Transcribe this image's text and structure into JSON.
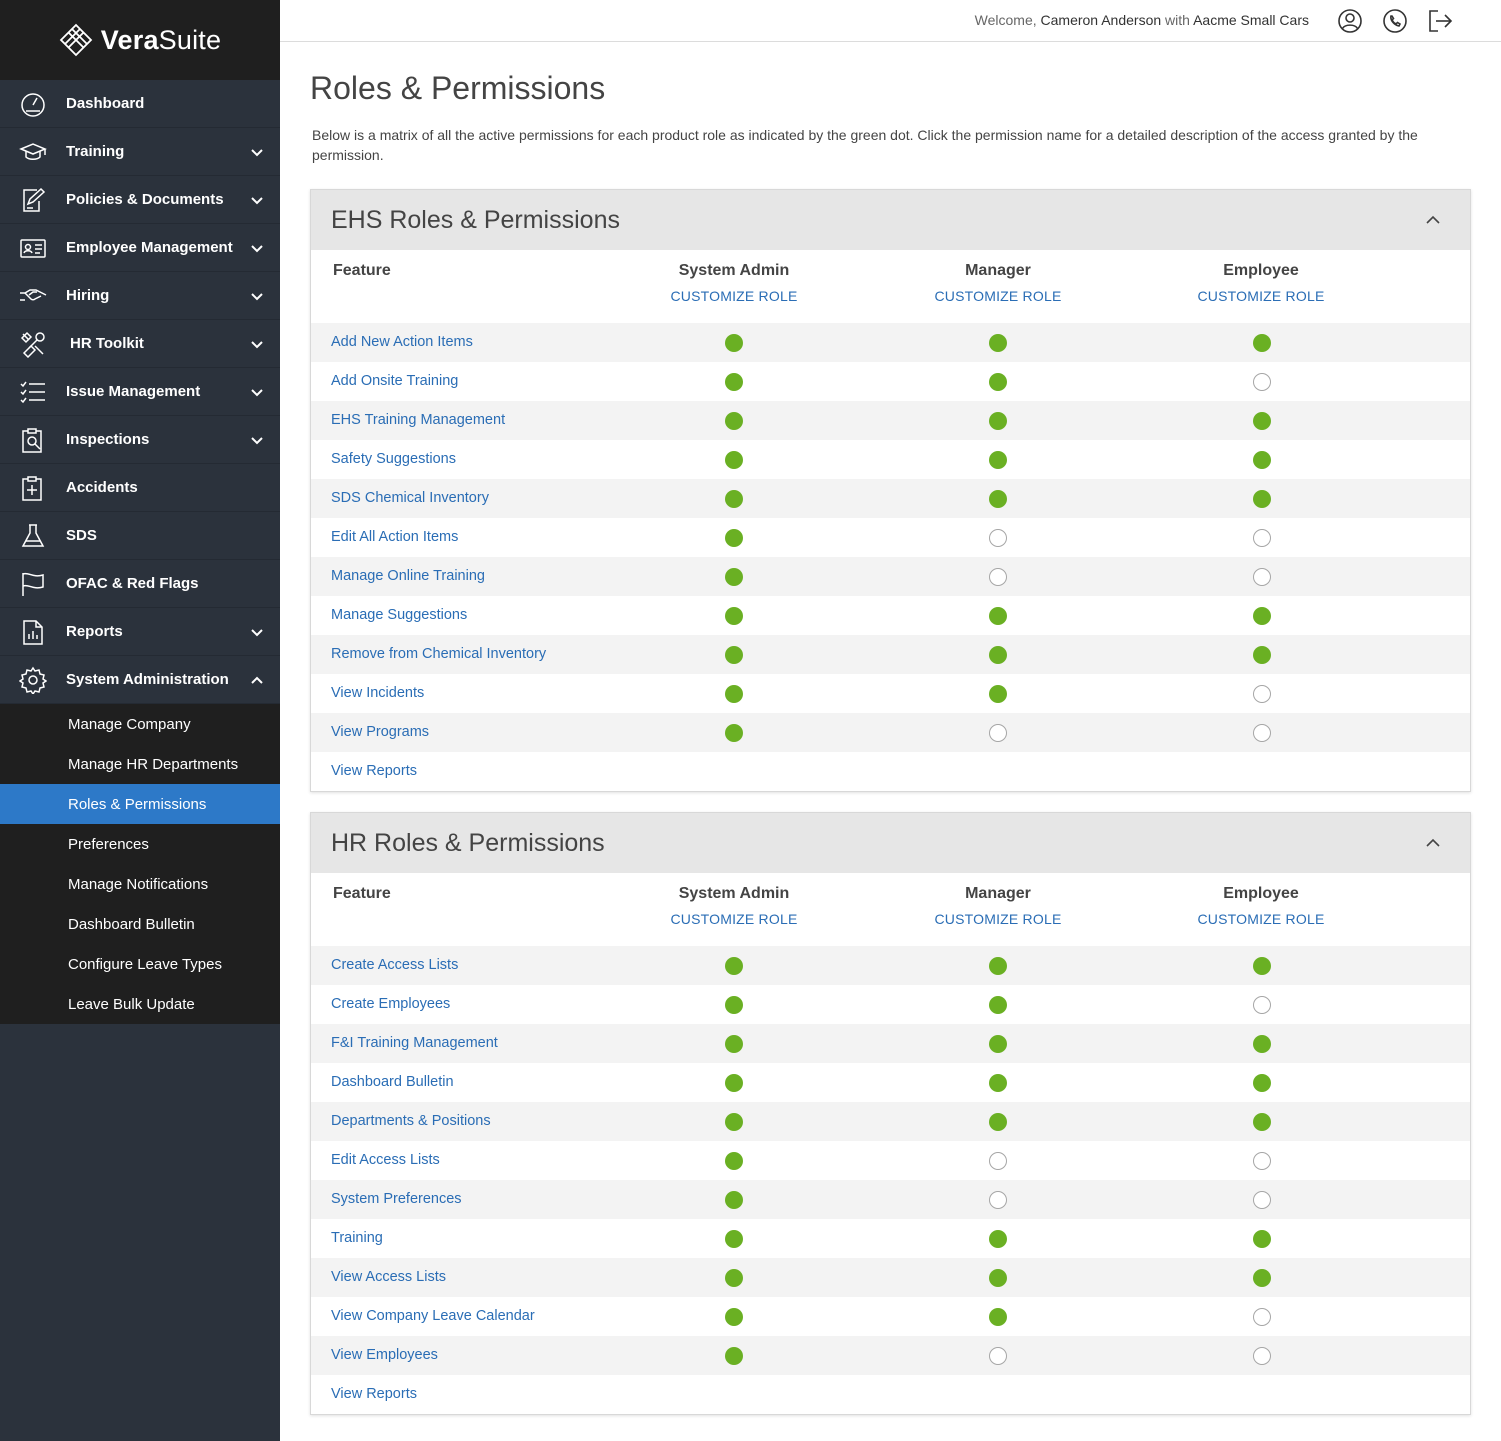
{
  "brand": {
    "name_bold": "Vera",
    "name_rest": "Suite"
  },
  "sidebar": {
    "items": [
      {
        "label": "Dashboard",
        "icon": "gauge-icon",
        "chevron": false
      },
      {
        "label": "Training",
        "icon": "graduation-cap-icon",
        "chevron": true
      },
      {
        "label": "Policies & Documents",
        "icon": "document-pen-icon",
        "chevron": true
      },
      {
        "label": "Employee Management",
        "icon": "id-card-icon",
        "chevron": true
      },
      {
        "label": "Hiring",
        "icon": "handshake-icon",
        "chevron": true
      },
      {
        "label": "HR Toolkit",
        "icon": "tools-icon",
        "chevron": true
      },
      {
        "label": "Issue Management",
        "icon": "checklist-icon",
        "chevron": true
      },
      {
        "label": "Inspections",
        "icon": "clipboard-search-icon",
        "chevron": true
      },
      {
        "label": "Accidents",
        "icon": "medical-clipboard-icon",
        "chevron": false
      },
      {
        "label": "SDS",
        "icon": "flask-icon",
        "chevron": false
      },
      {
        "label": "OFAC & Red Flags",
        "icon": "flag-icon",
        "chevron": false
      },
      {
        "label": "Reports",
        "icon": "report-icon",
        "chevron": true
      },
      {
        "label": "System Administration",
        "icon": "gear-icon",
        "chevron": true,
        "expanded": true
      }
    ],
    "subitems": [
      {
        "label": "Manage Company"
      },
      {
        "label": "Manage HR Departments"
      },
      {
        "label": "Roles & Permissions",
        "active": true
      },
      {
        "label": "Preferences"
      },
      {
        "label": "Manage Notifications"
      },
      {
        "label": "Dashboard Bulletin"
      },
      {
        "label": "Configure Leave Types"
      },
      {
        "label": "Leave Bulk Update"
      }
    ]
  },
  "topbar": {
    "welcome_prefix": "Welcome,",
    "user": "Cameron Anderson",
    "with": "with",
    "company": "Aacme Small Cars",
    "icons": [
      "user-circle-icon",
      "phone-icon",
      "logout-icon"
    ]
  },
  "page": {
    "title": "Roles & Permissions",
    "intro": "Below is a matrix of all the active permissions for each product role as indicated by the green dot. Click the permission name for a detailed description of the access granted by the permission."
  },
  "colors": {
    "active_dot": "#6ab023",
    "link": "#2a6db5",
    "active_nav": "#2d79c8",
    "sidebar_bg": "#2b323c"
  },
  "panels": [
    {
      "title": "EHS Roles & Permissions",
      "feature_header": "Feature",
      "roles": [
        {
          "name": "System Admin",
          "action": "CUSTOMIZE ROLE"
        },
        {
          "name": "Manager",
          "action": "CUSTOMIZE ROLE"
        },
        {
          "name": "Employee",
          "action": "CUSTOMIZE ROLE"
        }
      ],
      "rows": [
        {
          "feature": "Add New Action Items",
          "perms": [
            true,
            true,
            true
          ]
        },
        {
          "feature": "Add Onsite Training",
          "perms": [
            true,
            true,
            false
          ]
        },
        {
          "feature": "EHS Training Management",
          "perms": [
            true,
            true,
            true
          ]
        },
        {
          "feature": "Safety Suggestions",
          "perms": [
            true,
            true,
            true
          ]
        },
        {
          "feature": "SDS Chemical Inventory",
          "perms": [
            true,
            true,
            true
          ]
        },
        {
          "feature": "Edit All Action Items",
          "perms": [
            true,
            false,
            false
          ]
        },
        {
          "feature": "Manage Online Training",
          "perms": [
            true,
            false,
            false
          ]
        },
        {
          "feature": "Manage Suggestions",
          "perms": [
            true,
            true,
            true
          ]
        },
        {
          "feature": "Remove from Chemical Inventory",
          "perms": [
            true,
            true,
            true
          ]
        },
        {
          "feature": "View Incidents",
          "perms": [
            true,
            true,
            false
          ]
        },
        {
          "feature": "View Programs",
          "perms": [
            true,
            false,
            false
          ]
        },
        {
          "feature": "View Reports",
          "perms": [
            null,
            null,
            null
          ]
        }
      ]
    },
    {
      "title": "HR Roles & Permissions",
      "feature_header": "Feature",
      "roles": [
        {
          "name": "System Admin",
          "action": "CUSTOMIZE ROLE"
        },
        {
          "name": "Manager",
          "action": "CUSTOMIZE ROLE"
        },
        {
          "name": "Employee",
          "action": "CUSTOMIZE ROLE"
        }
      ],
      "rows": [
        {
          "feature": "Create Access Lists",
          "perms": [
            true,
            true,
            true
          ]
        },
        {
          "feature": "Create Employees",
          "perms": [
            true,
            true,
            false
          ]
        },
        {
          "feature": "F&I Training Management",
          "perms": [
            true,
            true,
            true
          ]
        },
        {
          "feature": "Dashboard Bulletin",
          "perms": [
            true,
            true,
            true
          ]
        },
        {
          "feature": "Departments & Positions",
          "perms": [
            true,
            true,
            true
          ]
        },
        {
          "feature": "Edit Access Lists",
          "perms": [
            true,
            false,
            false
          ]
        },
        {
          "feature": "System Preferences",
          "perms": [
            true,
            false,
            false
          ]
        },
        {
          "feature": "Training",
          "perms": [
            true,
            true,
            true
          ]
        },
        {
          "feature": "View Access Lists",
          "perms": [
            true,
            true,
            true
          ]
        },
        {
          "feature": "View Company Leave Calendar",
          "perms": [
            true,
            true,
            false
          ]
        },
        {
          "feature": "View Employees",
          "perms": [
            true,
            false,
            false
          ]
        },
        {
          "feature": "View Reports",
          "perms": [
            null,
            null,
            null
          ]
        }
      ]
    }
  ]
}
